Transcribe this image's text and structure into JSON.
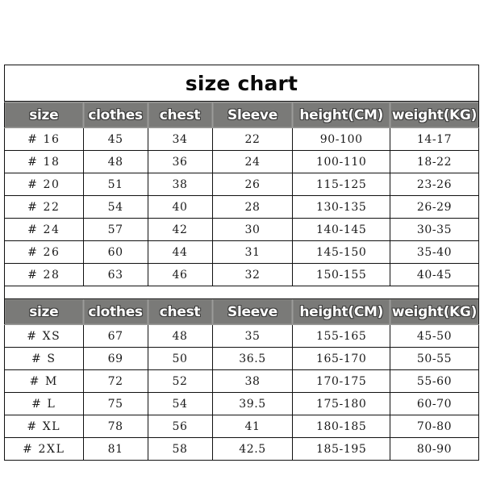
{
  "title": "size chart",
  "columns": [
    "size",
    "clothes",
    "chest",
    "Sleeve",
    "height(CM)",
    "weight(KG)"
  ],
  "colors": {
    "header_background": "#7a7a78",
    "header_text": "#ffffff",
    "header_text_outline": "#3d3d3c",
    "cell_background": "#ffffff",
    "cell_text": "#1a1a1a",
    "border": "#111111",
    "page_background": "#ffffff"
  },
  "tables": [
    {
      "id": "youth-size-table",
      "headers": [
        "size",
        "clothes",
        "chest",
        "Sleeve",
        "height(CM)",
        "weight(KG)"
      ],
      "rows": [
        [
          "# 16",
          "45",
          "34",
          "22",
          "90-100",
          "14-17"
        ],
        [
          "# 18",
          "48",
          "36",
          "24",
          "100-110",
          "18-22"
        ],
        [
          "# 20",
          "51",
          "38",
          "26",
          "115-125",
          "23-26"
        ],
        [
          "# 22",
          "54",
          "40",
          "28",
          "130-135",
          "26-29"
        ],
        [
          "# 24",
          "57",
          "42",
          "30",
          "140-145",
          "30-35"
        ],
        [
          "# 26",
          "60",
          "44",
          "31",
          "145-150",
          "35-40"
        ],
        [
          "# 28",
          "63",
          "46",
          "32",
          "150-155",
          "40-45"
        ]
      ]
    },
    {
      "id": "adult-size-table",
      "headers": [
        "size",
        "clothes",
        "chest",
        "Sleeve",
        "height(CM)",
        "weight(KG)"
      ],
      "rows": [
        [
          "# XS",
          "67",
          "48",
          "35",
          "155-165",
          "45-50"
        ],
        [
          "# S",
          "69",
          "50",
          "36.5",
          "165-170",
          "50-55"
        ],
        [
          "# M",
          "72",
          "52",
          "38",
          "170-175",
          "55-60"
        ],
        [
          "# L",
          "75",
          "54",
          "39.5",
          "175-180",
          "60-70"
        ],
        [
          "# XL",
          "78",
          "56",
          "41",
          "180-185",
          "70-80"
        ],
        [
          "# 2XL",
          "81",
          "58",
          "42.5",
          "185-195",
          "80-90"
        ]
      ]
    }
  ]
}
